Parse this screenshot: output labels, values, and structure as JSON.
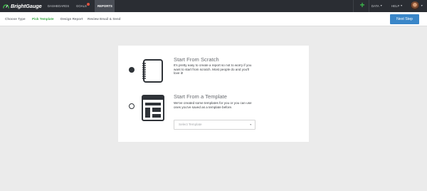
{
  "app": {
    "brand": "BrightGauge",
    "accent": "#3cab48",
    "topbar_color": "#2a2d33",
    "primary_button_color": "#3a86c8"
  },
  "nav": {
    "items": [
      {
        "label": "DASHBOARDS",
        "active": false
      },
      {
        "label": "GOALS",
        "active": false,
        "notification": true
      },
      {
        "label": "REPORTS",
        "active": true
      }
    ],
    "right": {
      "add_icon": "plus-icon",
      "data_label": "DATA",
      "help_label": "HELP",
      "avatar_icon": "user-avatar"
    }
  },
  "steps": {
    "items": [
      {
        "label": "Choose Type",
        "state": "done"
      },
      {
        "label": "Pick Template",
        "state": "current"
      },
      {
        "label": "Design Report",
        "state": "upcoming"
      },
      {
        "label": "Review Email & Send",
        "state": "upcoming"
      }
    ],
    "next_label": "Next Step"
  },
  "options": [
    {
      "title": "Start From Scratch",
      "description": "It's pretty easy to create a report so not to worry if you want to start from scratch. Most people do and you'll love it!",
      "selected": true,
      "icon": "notebook-icon"
    },
    {
      "title": "Start From a Template",
      "description": "We've created some templates for you or you can use ones you've saved as a template before.",
      "selected": false,
      "icon": "template-layout-icon"
    }
  ],
  "template_select": {
    "placeholder": "Select Template"
  }
}
